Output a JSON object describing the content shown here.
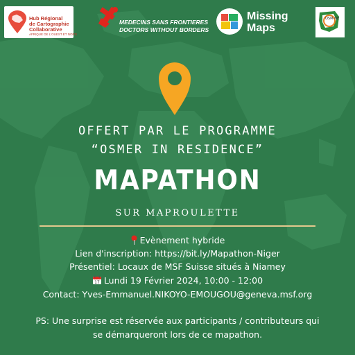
{
  "logos": {
    "hub": {
      "line1": "",
      "line2": "Hub Régional",
      "line3": "de Cartographie",
      "line4": "Collaborative",
      "line5": "AFRIQUE DE L'OUEST ET NORD"
    },
    "msf": {
      "line1": "MEDECINS SANS FRONTIERES",
      "line2": "DOCTORS WITHOUT BORDERS"
    },
    "missing_maps": {
      "line1": "Missing",
      "line2": "Maps"
    },
    "osm_niger": {
      "label": "OSM-NE"
    }
  },
  "header": {
    "offert": "OFFERT PAR LE PROGRAMME",
    "program": "“OSMER IN RESIDENCE”",
    "title": "MAPATHON",
    "subtitle": "SUR MAPROULETTE"
  },
  "info": {
    "event_type": "Evènement hybride",
    "registration": "Lien d'inscription: https://bit.ly/Mapathon-Niger",
    "venue": "Présentiel: Locaux de MSF Suisse situés à Niamey",
    "date": "Lundi 19 Février 2024, 10:00 - 12:00",
    "contact": "Contact: Yves-Emmanuel.NIKOYO-EMOUGOU@geneva.msf.org"
  },
  "ps": {
    "line1": "PS: Une surprise est réservée aux participants / contributeurs qui",
    "line2": "se démarqueront lors de ce mapathon."
  },
  "icons": {
    "pin": "location-pin-icon",
    "info_pin": "round-pushpin-icon",
    "calendar": "calendar-icon"
  },
  "colors": {
    "background": "#2f7b4b",
    "accent_pin": "#f6a623",
    "divider": "#e4c98e",
    "msf_red": "#e0261d"
  }
}
